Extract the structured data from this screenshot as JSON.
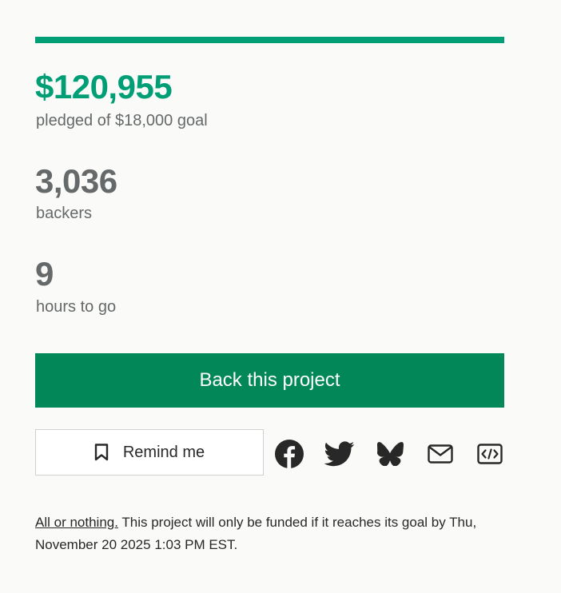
{
  "progress": {
    "percent": 100,
    "color": "#009e74"
  },
  "pledged": {
    "amount": "$120,955",
    "label": "pledged of $18,000 goal",
    "color": "#009e74"
  },
  "backers": {
    "count": "3,036",
    "label": "backers"
  },
  "time": {
    "count": "9",
    "label": "hours to go"
  },
  "back_button": {
    "label": "Back this project",
    "color": "#028858"
  },
  "remind_button": {
    "label": "Remind me",
    "icon": "bookmark-icon"
  },
  "share": [
    {
      "name": "facebook",
      "icon": "facebook-icon"
    },
    {
      "name": "twitter",
      "icon": "twitter-icon"
    },
    {
      "name": "bluesky",
      "icon": "bluesky-icon"
    },
    {
      "name": "email",
      "icon": "mail-icon"
    },
    {
      "name": "embed",
      "icon": "embed-icon"
    }
  ],
  "footnote": {
    "link": "All or nothing.",
    "text": " This project will only be funded if it reaches its goal by Thu, November 20 2025 1:03 PM EST."
  }
}
